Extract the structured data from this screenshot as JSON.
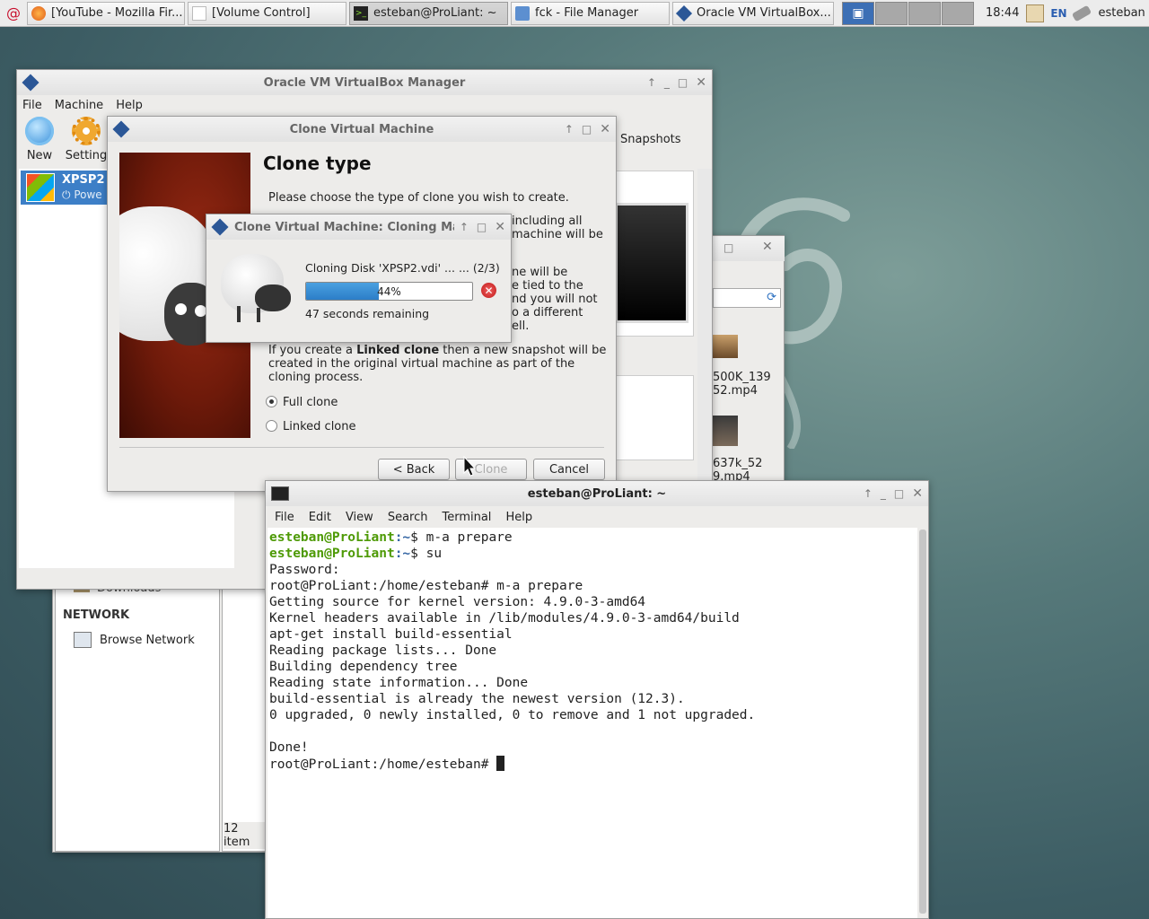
{
  "taskbar": {
    "tasks": [
      {
        "label": "[YouTube - Mozilla Fir...",
        "icon": "firefox-icon"
      },
      {
        "label": "[Volume Control]",
        "icon": "volume-icon"
      },
      {
        "label": "esteban@ProLiant: ~",
        "icon": "terminal-icon"
      },
      {
        "label": "fck - File Manager",
        "icon": "folder-icon"
      },
      {
        "label": "Oracle VM VirtualBox...",
        "icon": "virtualbox-icon"
      }
    ],
    "clock": "18:44",
    "keyboard_layout": "EN",
    "user": "esteban"
  },
  "vbox": {
    "title": "Oracle VM VirtualBox Manager",
    "menu": [
      "File",
      "Machine",
      "Help"
    ],
    "toolbar": {
      "new": "New",
      "settings": "Setting",
      "snapshots": "Snapshots"
    },
    "vm": {
      "name": "XPSP2",
      "state": "Powe"
    }
  },
  "filemanager": {
    "network_heading": "NETWORK",
    "browse_network": "Browse Network",
    "downloads": "Downloads",
    "status": "12 item",
    "files": [
      {
        "l1": "500K_139",
        "l2": "52.mp4"
      },
      {
        "l1": "637k_52",
        "l2": "9.mp4"
      }
    ]
  },
  "clone": {
    "title": "Clone Virtual Machine",
    "heading": "Clone type",
    "intro": "Please choose the type of clone you wish to create.",
    "frag1": "including all",
    "frag2": "machine will be",
    "frag3": "ne will be",
    "frag4": "e tied to the",
    "frag5": "nd you will not",
    "frag6": "o a different",
    "frag7": "ell.",
    "linked_pre": "If you create a ",
    "linked_bold": "Linked clone",
    "linked_post": " then a new snapshot will be",
    "linked_l2": "created in the original virtual machine as part of the",
    "linked_l3": "cloning process.",
    "option_full": "Full clone",
    "option_linked": "Linked clone",
    "selected": "Full clone",
    "btn_back": "< Back",
    "btn_clone": "Clone",
    "btn_cancel": "Cancel"
  },
  "progress": {
    "title": "Clone Virtual Machine: Cloning Ma",
    "operation": "Cloning Disk 'XPSP2.vdi' ... ... (2/3)",
    "percent": 44,
    "percent_label": "44%",
    "remaining": "47 seconds remaining"
  },
  "terminal": {
    "title": "esteban@ProLiant: ~",
    "menu": [
      "File",
      "Edit",
      "View",
      "Search",
      "Terminal",
      "Help"
    ],
    "user_prompt": "esteban@ProLiant",
    "prompt_path": ":~",
    "cmd1": "$ m-a prepare",
    "cmd2": "$ su",
    "lines": [
      "Password:",
      "root@ProLiant:/home/esteban# m-a prepare",
      "Getting source for kernel version: 4.9.0-3-amd64",
      "Kernel headers available in /lib/modules/4.9.0-3-amd64/build",
      "apt-get install build-essential",
      "Reading package lists... Done",
      "Building dependency tree",
      "Reading state information... Done",
      "build-essential is already the newest version (12.3).",
      "0 upgraded, 0 newly installed, 0 to remove and 1 not upgraded.",
      "",
      "Done!"
    ],
    "final_prompt": "root@ProLiant:/home/esteban# "
  }
}
